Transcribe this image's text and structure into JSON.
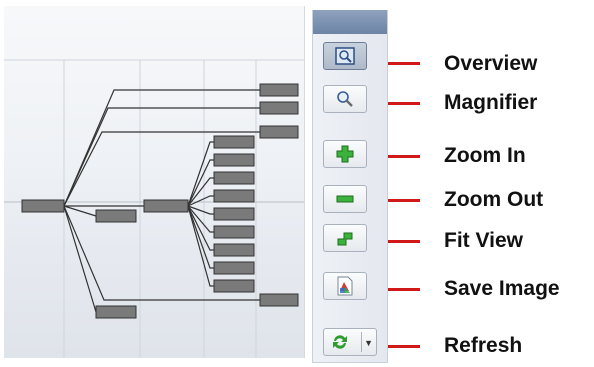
{
  "toolbar": {
    "buttons": [
      {
        "id": "overview",
        "label": "Overview",
        "icon": "overview-icon",
        "pressed": true
      },
      {
        "id": "magnifier",
        "label": "Magnifier",
        "icon": "magnifier-icon",
        "pressed": false
      },
      {
        "id": "zoom-in",
        "label": "Zoom In",
        "icon": "plus-icon",
        "pressed": false
      },
      {
        "id": "zoom-out",
        "label": "Zoom Out",
        "icon": "minus-icon",
        "pressed": false
      },
      {
        "id": "fit-view",
        "label": "Fit View",
        "icon": "fit-view-icon",
        "pressed": false
      },
      {
        "id": "save-image",
        "label": "Save Image",
        "icon": "save-image-icon",
        "pressed": false
      },
      {
        "id": "refresh",
        "label": "Refresh",
        "icon": "refresh-icon",
        "pressed": false,
        "has_dropdown": true
      }
    ]
  },
  "colors": {
    "callout_line": "#d11919",
    "node_fill": "#7a7a7a",
    "plus_green": "#2e9d2e",
    "toolbar_cap": "#7b90b0"
  }
}
